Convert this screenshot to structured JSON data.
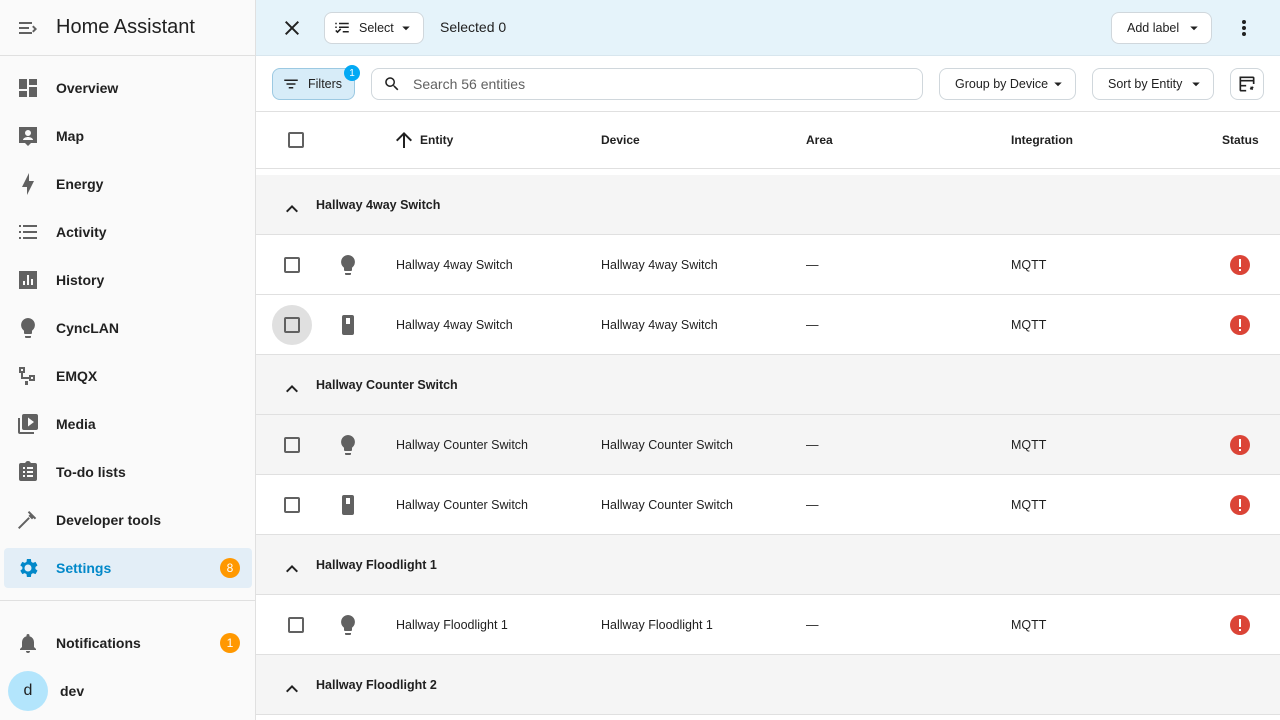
{
  "app": {
    "title": "Home Assistant"
  },
  "sidebar": {
    "items": [
      {
        "label": "Overview",
        "icon": "dashboard-icon"
      },
      {
        "label": "Map",
        "icon": "map-person-icon"
      },
      {
        "label": "Energy",
        "icon": "lightning-bolt-icon"
      },
      {
        "label": "Activity",
        "icon": "list-icon"
      },
      {
        "label": "History",
        "icon": "chart-box-icon"
      },
      {
        "label": "CyncLAN",
        "icon": "lightbulb-icon"
      },
      {
        "label": "EMQX",
        "icon": "connection-icon"
      },
      {
        "label": "Media",
        "icon": "play-box-icon"
      },
      {
        "label": "To-do lists",
        "icon": "clipboard-list-icon"
      },
      {
        "label": "Developer tools",
        "icon": "hammer-icon"
      },
      {
        "label": "Settings",
        "icon": "gear-icon",
        "active": true,
        "badge": "8"
      }
    ],
    "notifications": {
      "label": "Notifications",
      "badge": "1"
    },
    "user": {
      "initial": "d",
      "name": "dev"
    }
  },
  "selection_bar": {
    "select_label": "Select",
    "selected_text": "Selected 0",
    "add_label": "Add label"
  },
  "toolbar": {
    "filters_label": "Filters",
    "filters_count": "1",
    "search_placeholder": "Search 56 entities",
    "group_by": "Group by Device",
    "sort_by": "Sort by Entity"
  },
  "table": {
    "columns": {
      "entity": "Entity",
      "device": "Device",
      "area": "Area",
      "integration": "Integration",
      "status": "Status"
    },
    "groups": [
      {
        "name": "Hallway 4way Switch",
        "rows": [
          {
            "icon": "lightbulb-icon",
            "entity": "Hallway 4way Switch",
            "device": "Hallway 4way Switch",
            "area": "—",
            "integration": "MQTT"
          },
          {
            "icon": "light-switch-icon",
            "entity": "Hallway 4way Switch",
            "device": "Hallway 4way Switch",
            "area": "—",
            "integration": "MQTT"
          }
        ]
      },
      {
        "name": "Hallway Counter Switch",
        "rows": [
          {
            "icon": "lightbulb-icon",
            "entity": "Hallway Counter Switch",
            "device": "Hallway Counter Switch",
            "area": "—",
            "integration": "MQTT"
          },
          {
            "icon": "light-switch-icon",
            "entity": "Hallway Counter Switch",
            "device": "Hallway Counter Switch",
            "area": "—",
            "integration": "MQTT"
          }
        ]
      },
      {
        "name": "Hallway Floodlight 1",
        "rows": [
          {
            "icon": "lightbulb-icon",
            "entity": "Hallway Floodlight 1",
            "device": "Hallway Floodlight 1",
            "area": "—",
            "integration": "MQTT"
          }
        ]
      },
      {
        "name": "Hallway Floodlight 2",
        "rows": []
      }
    ]
  },
  "colors": {
    "accent": "#03a9f4",
    "badge": "#ff9800",
    "error": "#db4437",
    "selbar_bg": "#e5f3fa"
  }
}
